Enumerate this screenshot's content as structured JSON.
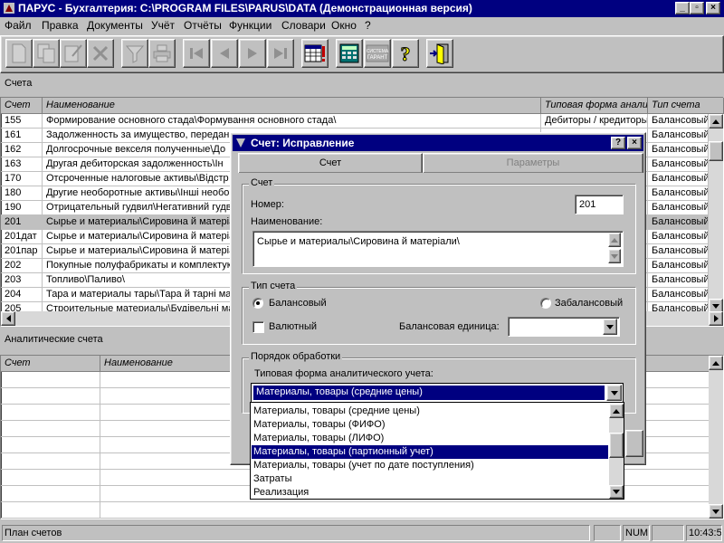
{
  "window": {
    "title": "ПАРУС - Бухгалтерия: C:\\PROGRAM FILES\\PARUS\\DATA (Демонстрационная версия)"
  },
  "menu": [
    "Файл",
    "Правка",
    "Документы",
    "Учёт",
    "Отчёты",
    "Функции",
    "Словари",
    "Окно",
    "?"
  ],
  "toolbar": {
    "buttons": [
      "new-doc-icon",
      "copy-icon",
      "edit-icon",
      "delete-icon",
      "filter-icon",
      "print-icon",
      "first-record-icon",
      "prev-record-icon",
      "next-record-icon",
      "last-record-icon",
      "table-icon",
      "calculator-icon",
      "consultant-icon",
      "help-icon",
      "exit-icon"
    ]
  },
  "accounts_pane": {
    "title": "Счета",
    "columns": [
      "Счет",
      "Наименование",
      "Типовая форма анали",
      "Тип счета"
    ],
    "rows": [
      {
        "code": "155",
        "name": "Формирование основного стада\\Формування основного стада\\",
        "form": "Дебиторы / кредиторы",
        "type": "Балансовый",
        "selected": false
      },
      {
        "code": "161",
        "name": "Задолженность за имущество, передан",
        "form": "",
        "type": "Балансовый",
        "selected": false
      },
      {
        "code": "162",
        "name": "Долгосрочные векселя полученные\\До",
        "form": "",
        "type": "Балансовый",
        "selected": false
      },
      {
        "code": "163",
        "name": "Другая дебиторская задолженность\\Ін",
        "form": "",
        "type": "Балансовый",
        "selected": false
      },
      {
        "code": "170",
        "name": "Отсроченные налоговые активы\\Відстр",
        "form": "",
        "type": "Балансовый",
        "selected": false
      },
      {
        "code": "180",
        "name": "Другие необоротные активы\\Інші необо",
        "form": "",
        "type": "Балансовый",
        "selected": false
      },
      {
        "code": "190",
        "name": "Отрицательный гудвил\\Негативний гудв",
        "form": "",
        "type": "Балансовый",
        "selected": false
      },
      {
        "code": "201",
        "name": "Сырье и материалы\\Сировина й матеріа",
        "form": "",
        "type": "Балансовый",
        "selected": true
      },
      {
        "code": "201дат",
        "name": "Сырье и материалы\\Сировина й матеріа",
        "form": "",
        "type": "Балансовый",
        "selected": false
      },
      {
        "code": "201пар",
        "name": "Сырье и материалы\\Сировина й матеріа",
        "form": "",
        "type": "Балансовый",
        "selected": false
      },
      {
        "code": "202",
        "name": "Покупные полуфабрикаты и комплектук",
        "form": "",
        "type": "Балансовый",
        "selected": false
      },
      {
        "code": "203",
        "name": "Топливо\\Паливо\\",
        "form": "",
        "type": "Балансовый",
        "selected": false
      },
      {
        "code": "204",
        "name": "Тара и материалы тары\\Тара й тарні ма",
        "form": "",
        "type": "Балансовый",
        "selected": false
      },
      {
        "code": "205",
        "name": "Строительные материалы\\Будівельні ма",
        "form": "",
        "type": "Балансовый",
        "selected": false
      }
    ]
  },
  "analytic_pane": {
    "title": "Аналитические счета",
    "columns": [
      "Счет",
      "Наименование"
    ]
  },
  "statusbar": {
    "text": "План счетов",
    "num": "NUM",
    "time": "10:43:56"
  },
  "dialog": {
    "title": "Счет: Исправление",
    "tabs": [
      "Счет",
      "Параметры"
    ],
    "group_account": "Счет",
    "number_label": "Номер:",
    "number_value": "201",
    "name_label": "Наименование:",
    "name_value": "Сырье и материалы\\Сировина й матеріали\\",
    "group_type": "Тип счета",
    "radio_balance": "Балансовый",
    "radio_offbalance": "Забалансовый",
    "check_currency": "Валютный",
    "balance_unit_label": "Балансовая единица:",
    "balance_unit_value": "",
    "group_processing": "Порядок обработки",
    "form_label": "Типовая форма аналитического учета:",
    "form_value": "Материалы, товары (средние цены)",
    "form_options": [
      "Материалы, товары (средние цены)",
      "Материалы, товары (ФИФО)",
      "Материалы, товары (ЛИФО)",
      "Материалы, товары (партионный учет)",
      "Материалы, товары (учет по дате поступления)",
      "Затраты",
      "Реализация"
    ],
    "highlighted_option": 3
  }
}
